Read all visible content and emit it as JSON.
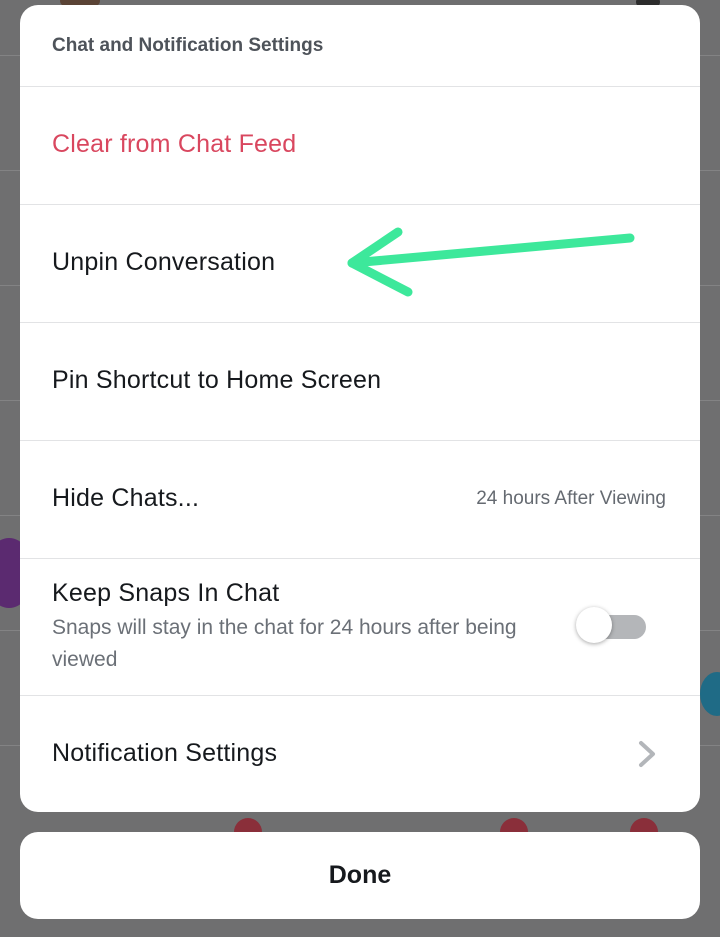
{
  "sheet": {
    "title": "Chat and Notification Settings",
    "items": [
      {
        "label": "Clear from Chat Feed",
        "style": "destructive"
      },
      {
        "label": "Unpin Conversation"
      },
      {
        "label": "Pin Shortcut to Home Screen"
      },
      {
        "label": "Hide Chats...",
        "value": "24 hours After Viewing"
      },
      {
        "label": "Keep Snaps In Chat",
        "subtitle": "Snaps will stay in the chat for 24 hours after being viewed",
        "toggle_on": false
      },
      {
        "label": "Notification Settings",
        "icon": "chevron-right-icon"
      }
    ]
  },
  "annotation": {
    "icon": "arrow-left-icon",
    "color": "#3de89b"
  },
  "done_label": "Done",
  "colors": {
    "destructive": "#d9475f",
    "text": "#16191d",
    "secondary": "#656a71",
    "toggle_track": "#b4b6b9"
  }
}
